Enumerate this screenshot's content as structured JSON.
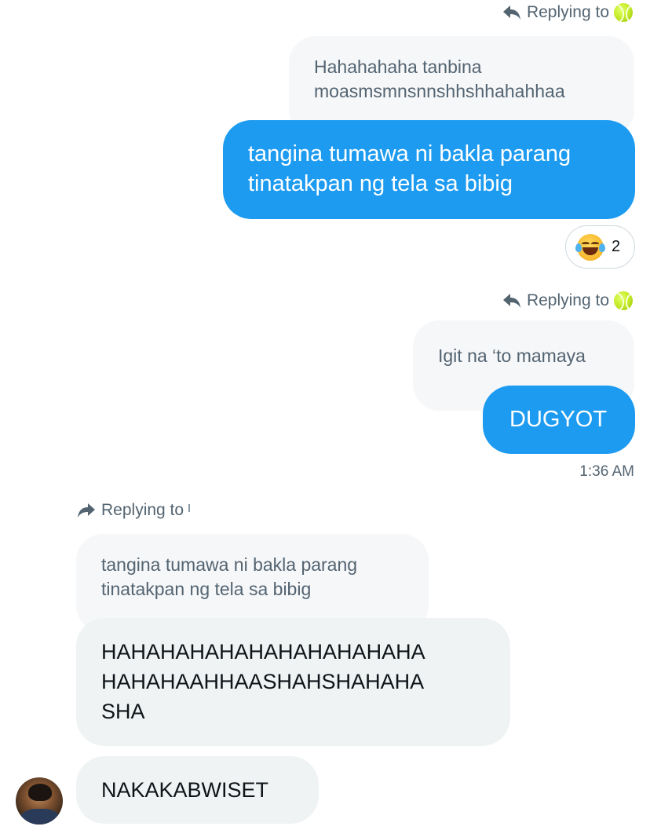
{
  "conversation": {
    "group1": {
      "replying_label": "Replying to",
      "quoted_text": "Hahahahaha tanbina moasmsmnsnnshhshhahahhaa",
      "sent_text": "tangina tumawa ni bakla parang tinatakpan ng tela sa bibig",
      "reaction": {
        "emoji": "face-with-tears-of-joy",
        "count": "2"
      }
    },
    "group2": {
      "replying_label": "Replying to",
      "quoted_text": "Igit na ‘to mamaya",
      "sent_text": "DUGYOT",
      "timestamp": "1:36 AM"
    },
    "group3": {
      "replying_label": "Replying to",
      "quoted_text": "tangina tumawa ni bakla parang tinatakpan ng tela sa bibig",
      "received_text": "HAHAHAHAHAHAHAHAHAHAHAHAHAHAAHHAASHAHSHAHAHASHA",
      "received_line1": "HAHAHAHAHAHAHAHAHAHAHA",
      "received_line2": "HAHAHAAHHAASHAHSHAHAHA",
      "received_line3": "SHA",
      "received_text_2": "NAKAKABWISET"
    }
  },
  "colors": {
    "sent_bubble": "#1d9bf0",
    "received_bubble": "#eff3f4",
    "quote_bubble": "#f6f7f9",
    "muted_text": "#536471"
  }
}
